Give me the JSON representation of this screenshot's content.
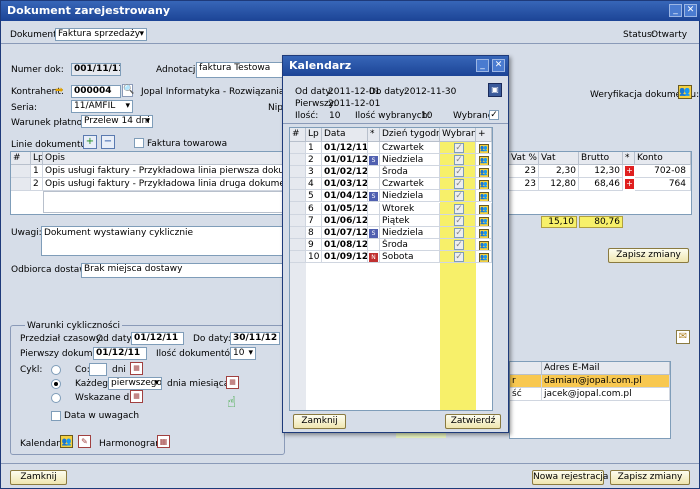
{
  "window": {
    "title": "Dokument zarejestrowany",
    "minimize": "_",
    "close": "✕"
  },
  "header": {
    "dokument_label": "Dokument:",
    "dokument_value": "Faktura sprzedaży",
    "status_label": "Status:",
    "status_value": "Otwarty"
  },
  "form": {
    "numer_label": "Numer dok:",
    "numer_value": "001/11/11",
    "adnotacja_label": "Adnotacja:",
    "adnotacja_value": "faktura Testowa",
    "kontrahent_label": "Kontrahent:",
    "kontrahent_value": "000004",
    "kontrahent_name": "Jopal Informatyka - Rozwiązania infor",
    "seria_label": "Seria:",
    "seria_value": "11/AMFIL",
    "nip_label": "Nip:",
    "warunek_label": "Warunek płatności:",
    "warunek_value": "Przelew 14 dni",
    "linie_label": "Linie dokumentu:",
    "faktura_towarowa": "Faktura towarowa",
    "weryfikacja_label": "Weryfikacja dokumentu:"
  },
  "lines": {
    "headers": [
      "#",
      "Lp",
      "Opis"
    ],
    "right_headers": [
      "Vat %",
      "Vat",
      "Brutto",
      "*",
      "Konto"
    ],
    "rows": [
      {
        "lp": "1",
        "opis": "Opis usługi faktury - Przykładowa linia pierwsza dokumentu generowa",
        "vatp": "23",
        "vat": "2,30",
        "brutto": "12,30",
        "konto": "702-08"
      },
      {
        "lp": "2",
        "opis": "Opis usługi faktury - Przykładowa linia druga dokumentu generowane",
        "vatp": "23",
        "vat": "12,80",
        "brutto": "68,46",
        "konto": "764"
      }
    ],
    "total_vat": "15,10",
    "total_brutto": "80,76"
  },
  "uwagi": {
    "label": "Uwagi:",
    "value": "Dokument wystawiany cyklicznie"
  },
  "odbiorca": {
    "label": "Odbiorca dostawy:",
    "value": "Brak miejsca dostawy"
  },
  "zapisz_zmiany_top": "Zapisz zmiany",
  "cykliczne": {
    "legend": "Warunki cykliczności",
    "przedzial_label": "Przedział czasowy:",
    "od_label": "Od daty:",
    "od_value": "01/12/11",
    "do_label": "Do daty:",
    "do_value": "30/11/12",
    "pierwszy_label": "Pierwszy dokument:",
    "pierwszy_value": "01/12/11",
    "ilosc_label": "Ilość dokumentów:",
    "ilosc_value": "10",
    "cykl_label": "Cykl:",
    "co_label": "Co:",
    "dni_label": "dni",
    "kazdego_label": "Każdego:",
    "kazdego_value": "pierwszego",
    "dnia_miesiaca": "dnia miesiąca",
    "wskazane_label": "Wskazane dni:",
    "data_w_uwagach": "Data w uwagach",
    "kalendarz_label": "Kalendarz:",
    "harmonogram_label": "Harmonogram:"
  },
  "emails": {
    "header": "Adres E-Mail",
    "rows": [
      {
        "col": "r",
        "email": "damian@jopal.com.pl"
      },
      {
        "col": "ść",
        "email": "jacek@jopal.com.pl"
      }
    ]
  },
  "footer": {
    "zamknij": "Zamknij",
    "nowa": "Nowa rejestracja",
    "zapisz": "Zapisz zmiany"
  },
  "calendar": {
    "title": "Kalendarz",
    "od_label": "Od daty:",
    "od_value": "2011-12-01",
    "do_label": "Do daty:",
    "do_value": "2012-11-30",
    "pierwszy_label": "Pierwszy:",
    "pierwszy_value": "2011-12-01",
    "ilosc_label": "Ilość:",
    "ilosc_value": "10",
    "ilosc_wybranych_label": "Ilość wybranych:",
    "ilosc_wybranych_value": "10",
    "wybrane_label": "Wybrane",
    "headers": [
      "#",
      "Lp",
      "Data",
      "*",
      "Dzień tygodnia",
      "Wybrane",
      "+"
    ],
    "rows": [
      {
        "lp": "1",
        "data": "01/12/11",
        "dzien": "Czwartek",
        "mark": ""
      },
      {
        "lp": "2",
        "data": "01/01/12",
        "dzien": "Niedziela",
        "mark": "S"
      },
      {
        "lp": "3",
        "data": "01/02/12",
        "dzien": "Środa",
        "mark": ""
      },
      {
        "lp": "4",
        "data": "01/03/12",
        "dzien": "Czwartek",
        "mark": ""
      },
      {
        "lp": "5",
        "data": "01/04/12",
        "dzien": "Niedziela",
        "mark": "S"
      },
      {
        "lp": "6",
        "data": "01/05/12",
        "dzien": "Wtorek",
        "mark": ""
      },
      {
        "lp": "7",
        "data": "01/06/12",
        "dzien": "Piątek",
        "mark": ""
      },
      {
        "lp": "8",
        "data": "01/07/12",
        "dzien": "Niedziela",
        "mark": "S"
      },
      {
        "lp": "9",
        "data": "01/08/12",
        "dzien": "Środa",
        "mark": ""
      },
      {
        "lp": "10",
        "data": "01/09/12",
        "dzien": "Sobota",
        "mark": "N"
      }
    ],
    "zamknij": "Zamknij",
    "zatwierdz": "Zatwierdź"
  }
}
